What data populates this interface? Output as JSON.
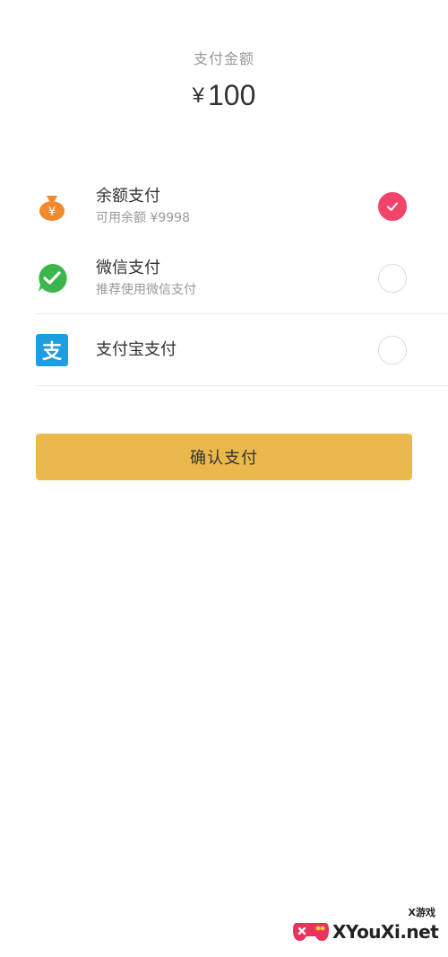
{
  "payment": {
    "label": "支付金额",
    "currency": "¥",
    "amount": "100"
  },
  "methods": [
    {
      "title": "余额支付",
      "subtitle": "可用余额 ¥9998",
      "icon": "money-bag-icon",
      "selected": true,
      "icon_color": "#f08a2c"
    },
    {
      "title": "微信支付",
      "subtitle": "推荐使用微信支付",
      "icon": "wechat-icon",
      "selected": false,
      "icon_color": "#3cb64a"
    },
    {
      "title": "支付宝支付",
      "subtitle": "",
      "icon": "alipay-icon",
      "selected": false,
      "icon_color": "#1e9de3"
    }
  ],
  "confirm": {
    "label": "确认支付"
  },
  "colors": {
    "accent_check": "#f0446b",
    "button": "#ebb94b"
  },
  "watermark": {
    "brand": "XYouXi.net",
    "tag": "X游戏"
  }
}
